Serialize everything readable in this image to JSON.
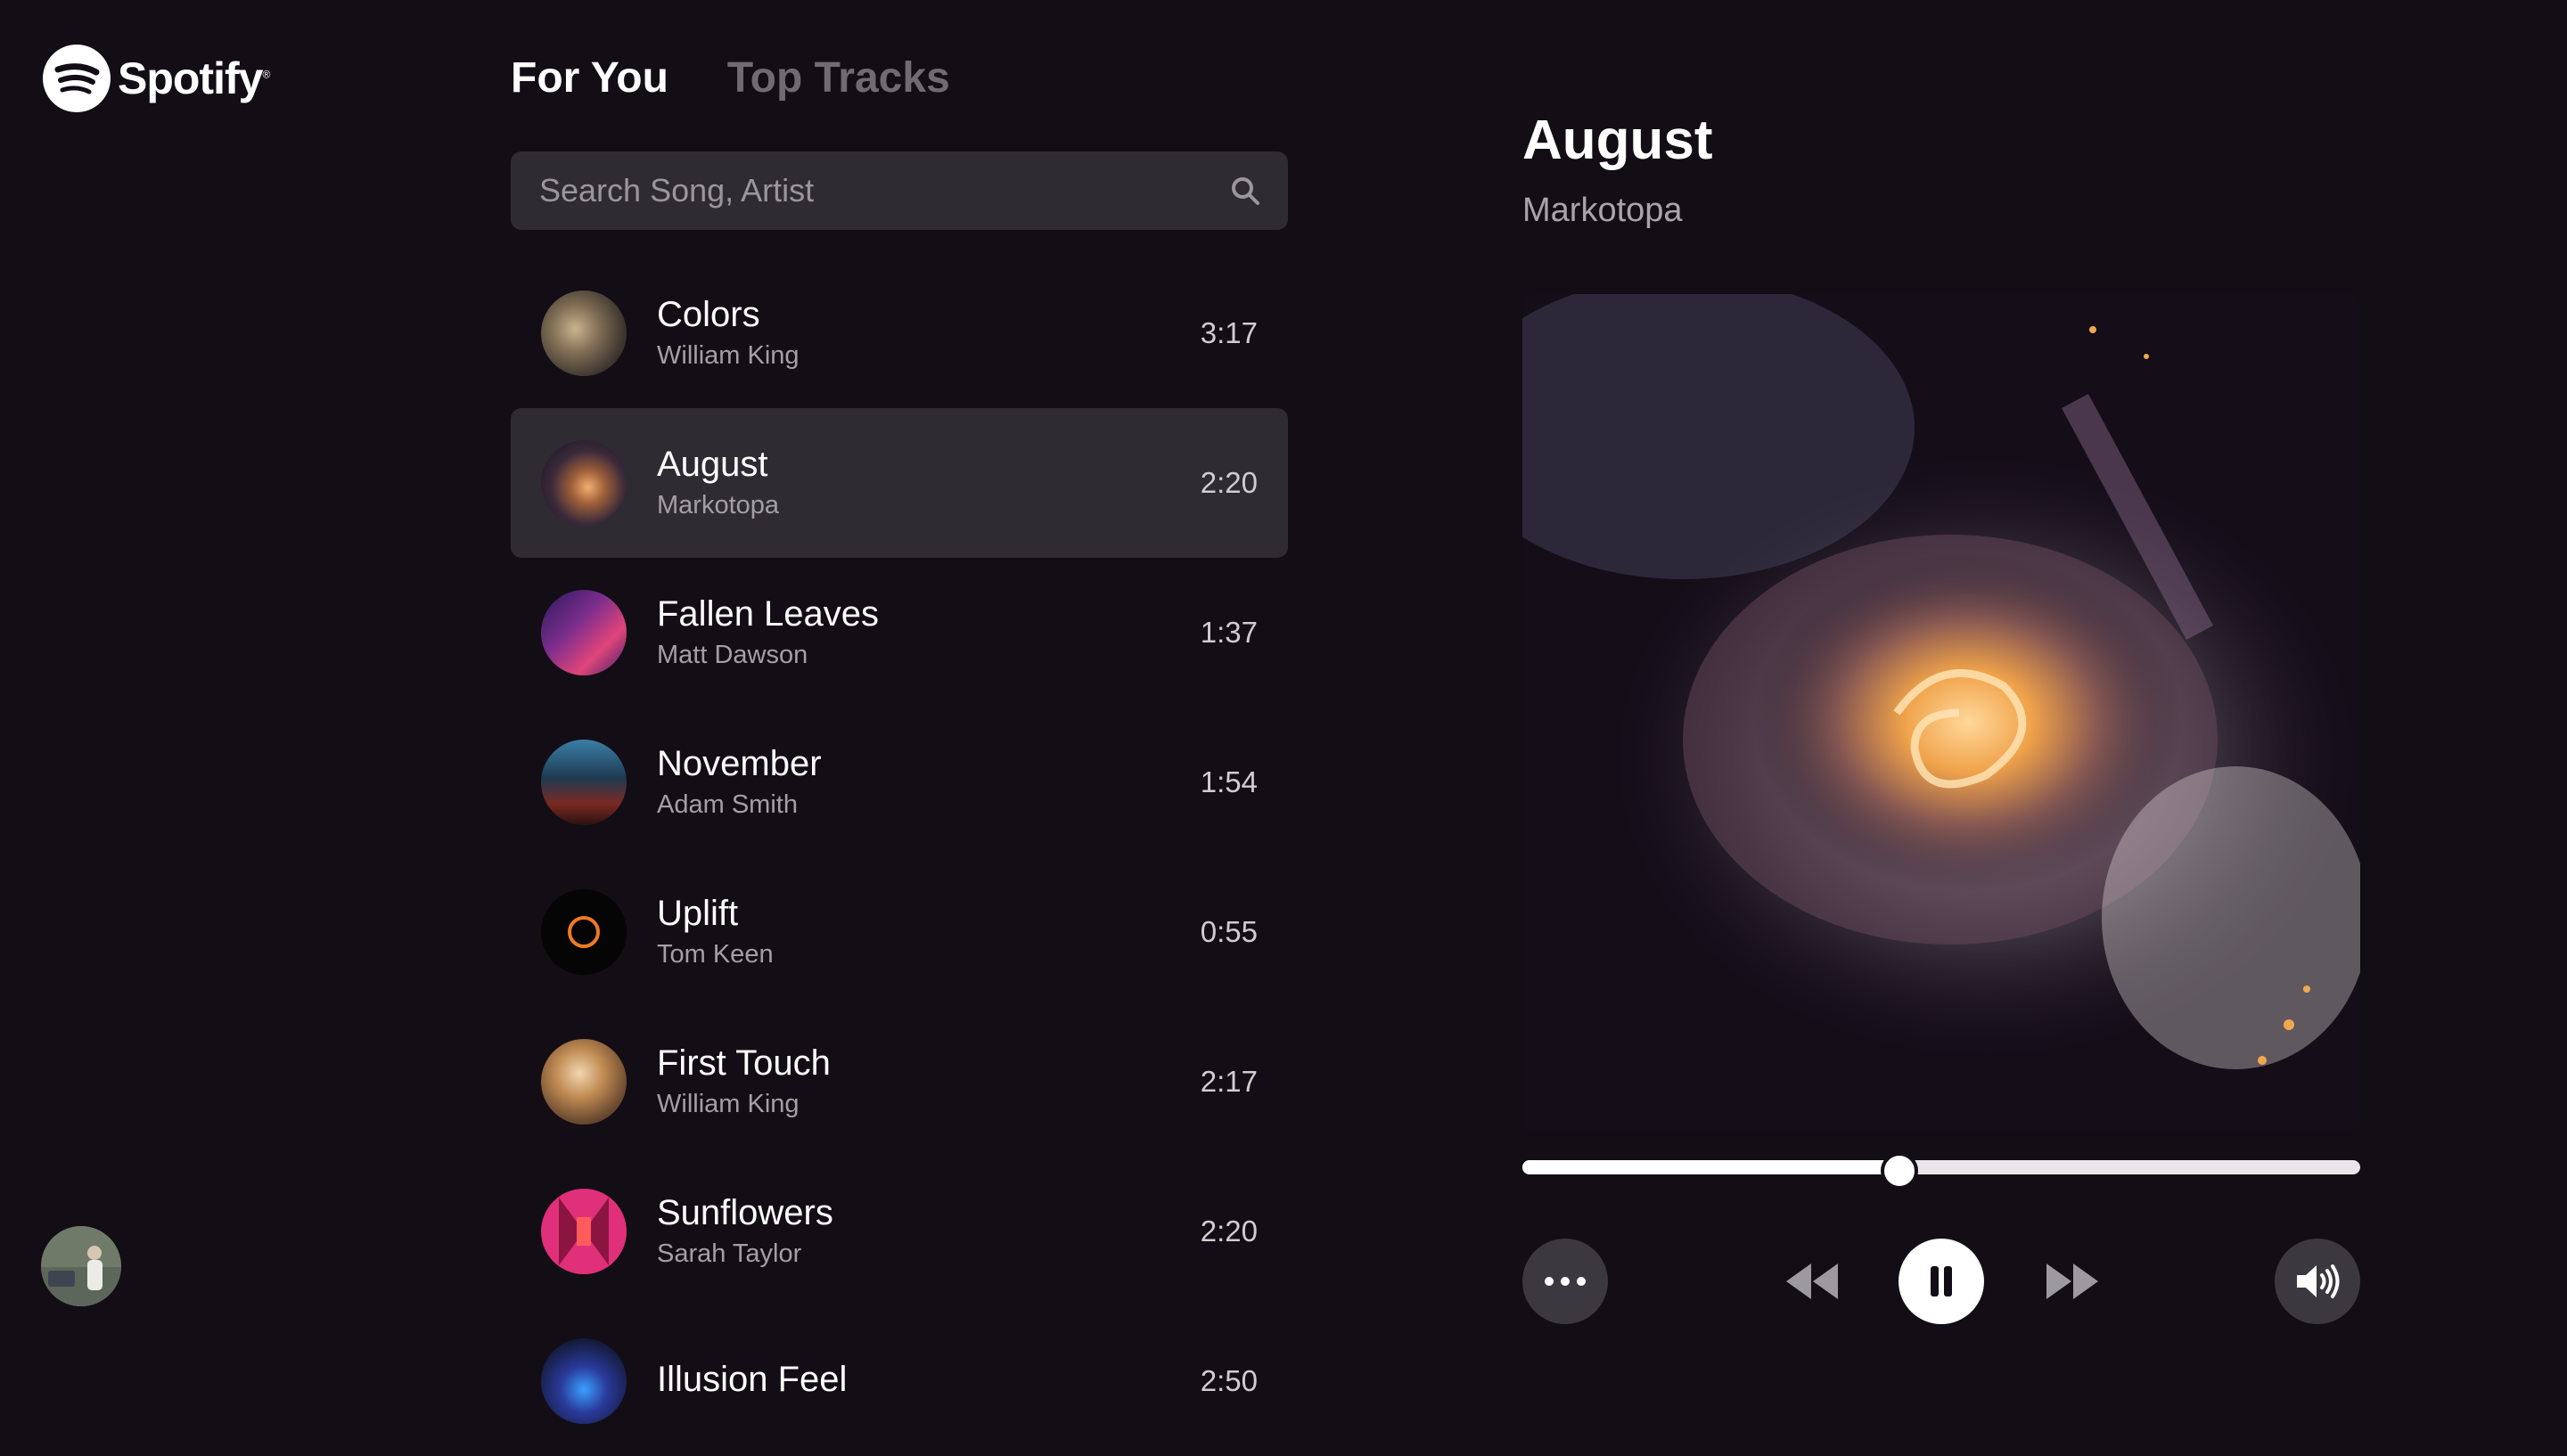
{
  "brand": {
    "name": "Spotify",
    "reg": "®"
  },
  "tabs": [
    {
      "label": "For You",
      "active": true
    },
    {
      "label": "Top Tracks",
      "active": false
    }
  ],
  "search": {
    "placeholder": "Search Song, Artist",
    "value": ""
  },
  "tracks": [
    {
      "title": "Colors",
      "artist": "William King",
      "duration": "3:17",
      "active": false
    },
    {
      "title": "August",
      "artist": "Markotopa",
      "duration": "2:20",
      "active": true
    },
    {
      "title": "Fallen Leaves",
      "artist": "Matt Dawson",
      "duration": "1:37",
      "active": false
    },
    {
      "title": "November",
      "artist": "Adam Smith",
      "duration": "1:54",
      "active": false
    },
    {
      "title": "Uplift",
      "artist": "Tom Keen",
      "duration": "0:55",
      "active": false
    },
    {
      "title": "First Touch",
      "artist": "William King",
      "duration": "2:17",
      "active": false
    },
    {
      "title": "Sunflowers",
      "artist": "Sarah Taylor",
      "duration": "2:20",
      "active": false
    },
    {
      "title": "Illusion Feel",
      "artist": "",
      "duration": "2:50",
      "active": false
    }
  ],
  "now_playing": {
    "title": "August",
    "artist": "Markotopa",
    "progress": 0.45
  },
  "controls": {
    "more": "more-icon",
    "previous": "previous-icon",
    "pause": "pause-icon",
    "next": "next-icon",
    "volume": "volume-icon"
  },
  "colors": {
    "background": "#130d15",
    "panel": "#2f2b32",
    "muted_text": "#a3a0a5",
    "inactive_tab": "#6e6c72"
  }
}
